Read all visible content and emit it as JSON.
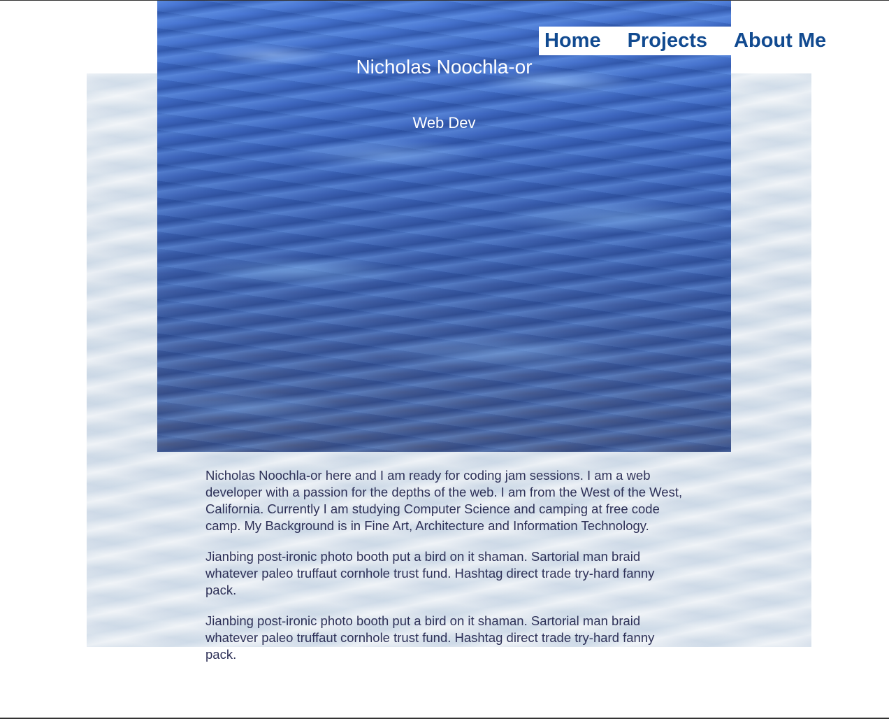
{
  "header": {
    "name": "Nicholas Noochla-or",
    "role": "Web Dev"
  },
  "nav": {
    "items": [
      {
        "label": "Home"
      },
      {
        "label": "Projects"
      },
      {
        "label": "About Me"
      }
    ]
  },
  "about": {
    "paragraphs": [
      "Nicholas Noochla-or here and I am ready for coding jam sessions. I am a web developer with a passion for the depths of the web. I am from the West of the West, California. Currently I am studying Computer Science and camping at free code camp. My Background is in Fine Art, Architecture and Information Technology.",
      "Jianbing post-ironic photo booth put a bird on it shaman. Sartorial man braid whatever paleo truffaut cornhole trust fund. Hashtag direct trade try-hard fanny pack.",
      "Jianbing post-ironic photo booth put a bird on it shaman. Sartorial man braid whatever paleo truffaut cornhole trust fund. Hashtag direct trade try-hard fanny pack."
    ]
  },
  "colors": {
    "nav_link": "#114a90",
    "body_text": "#2e3158",
    "hero_text": "#ffffff"
  }
}
